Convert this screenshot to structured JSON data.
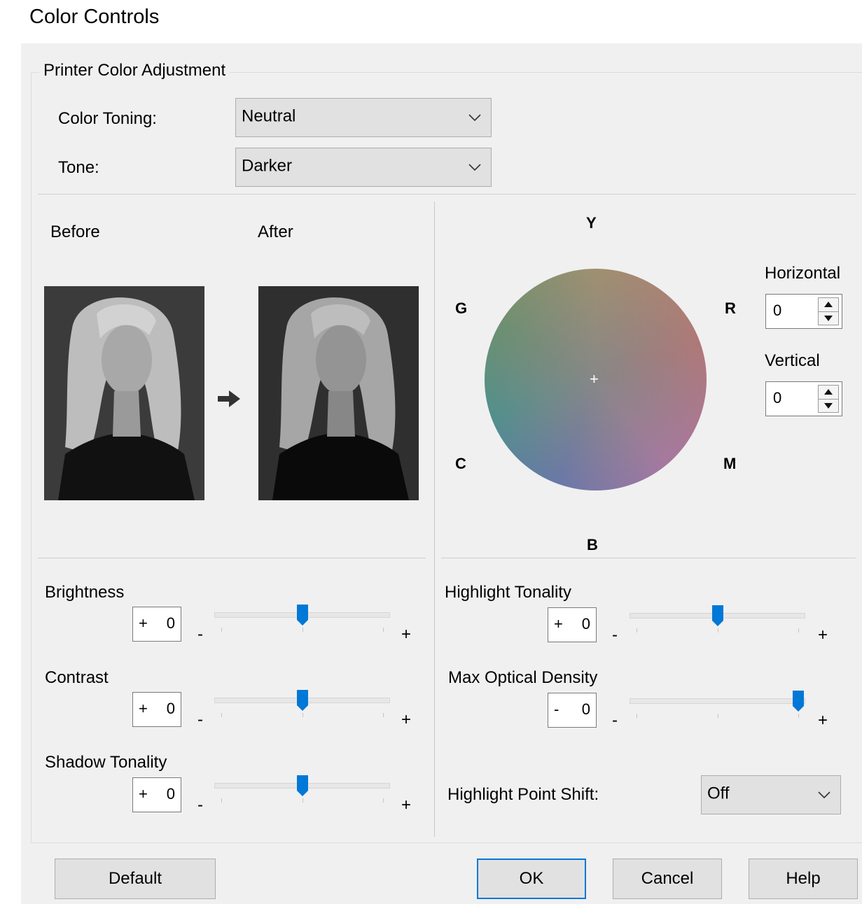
{
  "window": {
    "title": "Color Controls"
  },
  "group": {
    "legend": "Printer Color Adjustment"
  },
  "color_toning": {
    "label": "Color Toning:",
    "value": "Neutral"
  },
  "tone": {
    "label": "Tone:",
    "value": "Darker"
  },
  "preview": {
    "before_label": "Before",
    "after_label": "After"
  },
  "wheel": {
    "labels": {
      "top": "Y",
      "left_top": "G",
      "right_top": "R",
      "left_bottom": "C",
      "right_bottom": "M",
      "bottom": "B"
    },
    "center_marker": "+"
  },
  "horizontal": {
    "label": "Horizontal",
    "value": "0"
  },
  "vertical": {
    "label": "Vertical",
    "value": "0"
  },
  "minus_symbol": "-",
  "plus_symbol": "+",
  "sliders": {
    "brightness": {
      "label": "Brightness",
      "sign": "+",
      "value": "0",
      "position": 0.5
    },
    "contrast": {
      "label": "Contrast",
      "sign": "+",
      "value": "0",
      "position": 0.5
    },
    "shadow": {
      "label": "Shadow Tonality",
      "sign": "+",
      "value": "0",
      "position": 0.5
    },
    "highlight": {
      "label": "Highlight Tonality",
      "sign": "+",
      "value": "0",
      "position": 0.5
    },
    "max_density": {
      "label": "Max Optical Density",
      "sign": "-",
      "value": "0",
      "position": 1.0
    }
  },
  "highlight_point_shift": {
    "label": "Highlight Point Shift:",
    "value": "Off"
  },
  "buttons": {
    "default": "Default",
    "ok": "OK",
    "cancel": "Cancel",
    "help": "Help"
  },
  "colors": {
    "accent": "#0078d7",
    "panel": "#f0f0f0"
  }
}
